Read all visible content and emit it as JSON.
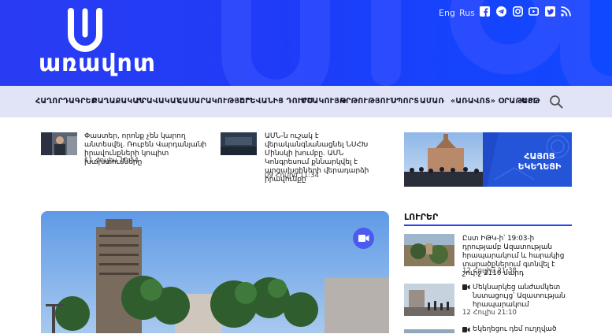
{
  "header": {
    "logo_text": "առավոտ",
    "lang_eng": "Eng",
    "lang_rus": "Rus",
    "social_icons": [
      "facebook-icon",
      "telegram-icon",
      "instagram-icon",
      "youtube-icon",
      "twitter-icon",
      "rss-icon"
    ]
  },
  "nav": {
    "items": [
      "ՀԱՂՈՐԴԱԳՐԵՐ",
      "ՔԱՂԱՔԱԿԱՆ",
      "ԻՐԱՎԱԿԱՆ",
      "ՀԱՍԱՐԱԿՈՒԹՅՈՒՆ",
      "ԵՐԵՎԱՆԻՑ ԴՈՒՐՍ",
      "ՄՇԱԿՈՒՅԹ",
      "ԿՐԹՈՒԹՅՈՒՆ",
      "ՍՊՈՐՏ",
      "ԱՄԱՌ",
      "«ԱՌԱՎՈՏ» ՕՐԱԹԵՐԹ",
      "ԱՅԼ"
    ]
  },
  "top_news": [
    {
      "title": "Փաստեր, որոնք չեն կարող անտեսվել. Ռուբեն Վարդանյանի իրավունքների կոպիտ խախտումները",
      "date": "11 Հուլիս 10:54"
    },
    {
      "title": "ԱՄՆ-ն ուշակ է վերականգնանացնել ՆՍՀԽ Մինսկի խումբը. ԱՄՆ Կոնգրեսում քննարկվել է արցախցիների վերադարձի իրավունքը",
      "date": "09 Հուլիս 11:34"
    }
  ],
  "banner": {
    "line1": "ՀԱՅՈՑ",
    "line2": "ԵԿԵՂԵՑԻ"
  },
  "lurer": {
    "title": "ԼՈՒՐԵՐ",
    "items": [
      {
        "title": "Ըստ ԻԹԿ-ի՝ 19:03-ի դրությամբ Ազատության հրապարակում և հարակից տարածքներում գտնվել է շուրջ 2110 մարդ",
        "date": "12 Հուլիս 21:38"
      },
      {
        "title": "Մեկնարկեց անժամկետ նստացույց՝ Ազատության հրապարակում",
        "date": "12 Հուլիս 21:10"
      },
      {
        "title": "Եկեղեցու դեմ ուղղված",
        "date": ""
      }
    ]
  },
  "colors": {
    "brand": "#2a3cf2",
    "nav_bg": "#e1e4f7",
    "accent": "#2740f0"
  }
}
